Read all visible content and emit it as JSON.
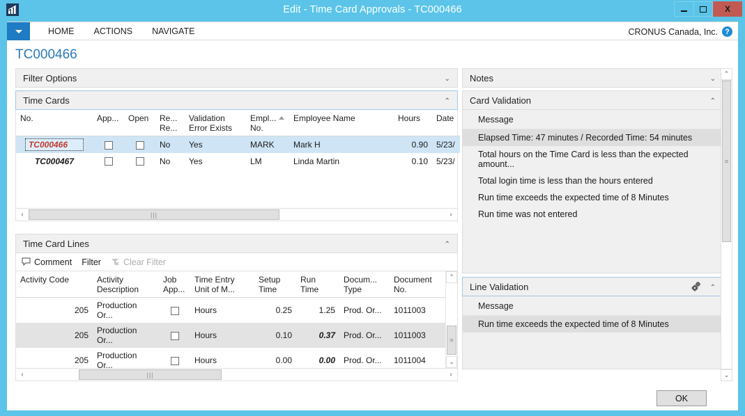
{
  "window": {
    "title": "Edit - Time Card Approvals - TC000466",
    "app_icon": "bar-chart-icon",
    "controls": {
      "minimize": "–",
      "maximize": "□",
      "close": "X"
    }
  },
  "ribbon": {
    "dropdown": "▼",
    "tabs": [
      "HOME",
      "ACTIONS",
      "NAVIGATE"
    ],
    "company": "CRONUS Canada, Inc.",
    "help": "?"
  },
  "page": {
    "title": "TC000466"
  },
  "filter_options": {
    "label": "Filter Options",
    "chevron": "⌄"
  },
  "time_cards": {
    "label": "Time Cards",
    "chevron": "⌃",
    "columns": [
      "No.",
      "App...",
      "Open",
      "Re... Re...",
      "Validation Error Exists",
      "Empl... No.",
      "Employee Name",
      "Hours",
      "Date"
    ],
    "columns_split": [
      {
        "l1": "No.",
        "l2": ""
      },
      {
        "l1": "App...",
        "l2": ""
      },
      {
        "l1": "Open",
        "l2": ""
      },
      {
        "l1": "Re...",
        "l2": "Re..."
      },
      {
        "l1": "Validation",
        "l2": "Error Exists"
      },
      {
        "l1": "Empl...",
        "l2": "No."
      },
      {
        "l1": "Employee Name",
        "l2": ""
      },
      {
        "l1": "Hours",
        "l2": ""
      },
      {
        "l1": "Date",
        "l2": ""
      }
    ],
    "sorted_column": "Empl... No.",
    "rows": [
      {
        "no": "TC000466",
        "approved": false,
        "open": false,
        "re_re": "No",
        "validation_error": "Yes",
        "empl_no": "MARK",
        "employee_name": "Mark H",
        "hours": "0.90",
        "date": "5/23/",
        "selected": true
      },
      {
        "no": "TC000467",
        "approved": false,
        "open": false,
        "re_re": "No",
        "validation_error": "Yes",
        "empl_no": "LM",
        "employee_name": "Linda Martin",
        "hours": "0.10",
        "date": "5/23/",
        "selected": false
      }
    ],
    "hscroll": {
      "left_arrow": "‹",
      "right_arrow": "›",
      "grip": "|||"
    }
  },
  "time_card_lines": {
    "label": "Time Card Lines",
    "chevron": "⌃",
    "toolbar": {
      "comment": "Comment",
      "comment_icon": "comment-bubble-icon",
      "filter": "Filter",
      "clear_filter": "Clear Filter",
      "clear_filter_icon": "clear-filter-icon"
    },
    "columns_split": [
      {
        "l1": "Activity Code",
        "l2": ""
      },
      {
        "l1": "Activity",
        "l2": "Description"
      },
      {
        "l1": "Job",
        "l2": "App..."
      },
      {
        "l1": "Time Entry",
        "l2": "Unit of M..."
      },
      {
        "l1": "Setup",
        "l2": "Time"
      },
      {
        "l1": "Run Time",
        "l2": ""
      },
      {
        "l1": "Docum...",
        "l2": "Type"
      },
      {
        "l1": "Document",
        "l2": "No."
      }
    ],
    "rows": [
      {
        "activity_code": "205",
        "activity_description": "Production Or...",
        "job_app": false,
        "time_entry_uom": "Hours",
        "setup_time": "0.25",
        "run_time": "1.25",
        "run_time_alert": false,
        "document_type": "Prod. Or...",
        "document_no": "1011003",
        "selected": false
      },
      {
        "activity_code": "205",
        "activity_description": "Production Or...",
        "job_app": false,
        "time_entry_uom": "Hours",
        "setup_time": "0.10",
        "run_time": "0.37",
        "run_time_alert": true,
        "document_type": "Prod. Or...",
        "document_no": "1011003",
        "selected": true
      },
      {
        "activity_code": "205",
        "activity_description": "Production Or...",
        "job_app": false,
        "time_entry_uom": "Hours",
        "setup_time": "0.00",
        "run_time": "0.00",
        "run_time_alert": true,
        "document_type": "Prod. Or...",
        "document_no": "1011004",
        "selected": false
      }
    ],
    "hscroll": {
      "left_arrow": "‹",
      "right_arrow": "›",
      "grip": "|||"
    },
    "vscroll": {
      "up": "⌃",
      "down": "⌄",
      "grip": "≡"
    }
  },
  "notes": {
    "label": "Notes",
    "chevron": "⌄"
  },
  "card_validation": {
    "label": "Card Validation",
    "chevron": "⌃",
    "column_header": "Message",
    "messages": [
      {
        "text": "Elapsed Time: 47 minutes / Recorded Time: 54 minutes",
        "highlighted": true
      },
      {
        "text": "Total hours on the Time Card is less than the expected amount...",
        "highlighted": false
      },
      {
        "text": "Total login time is less than the hours entered",
        "highlighted": false
      },
      {
        "text": "Run time exceeds the expected time of 8 Minutes",
        "highlighted": false
      },
      {
        "text": "Run time was not entered",
        "highlighted": false
      }
    ]
  },
  "line_validation": {
    "label": "Line Validation",
    "chevron": "⌃",
    "gear_icon": "gears-icon",
    "column_header": "Message",
    "messages": [
      {
        "text": "Run time exceeds the expected time of 8 Minutes",
        "highlighted": true
      }
    ]
  },
  "right_scroll": {
    "up": "⌃",
    "down": "⌄",
    "grip": "≡"
  },
  "footer": {
    "ok": "OK"
  },
  "colors": {
    "window_frame": "#5bc4e8",
    "accent_blue": "#1e7bc4",
    "page_title": "#2a7ab8",
    "selection": "#cfe5f5",
    "alert_red": "#c0392b",
    "close_button": "#c15a52",
    "panel_gray": "#f0f0f0"
  }
}
